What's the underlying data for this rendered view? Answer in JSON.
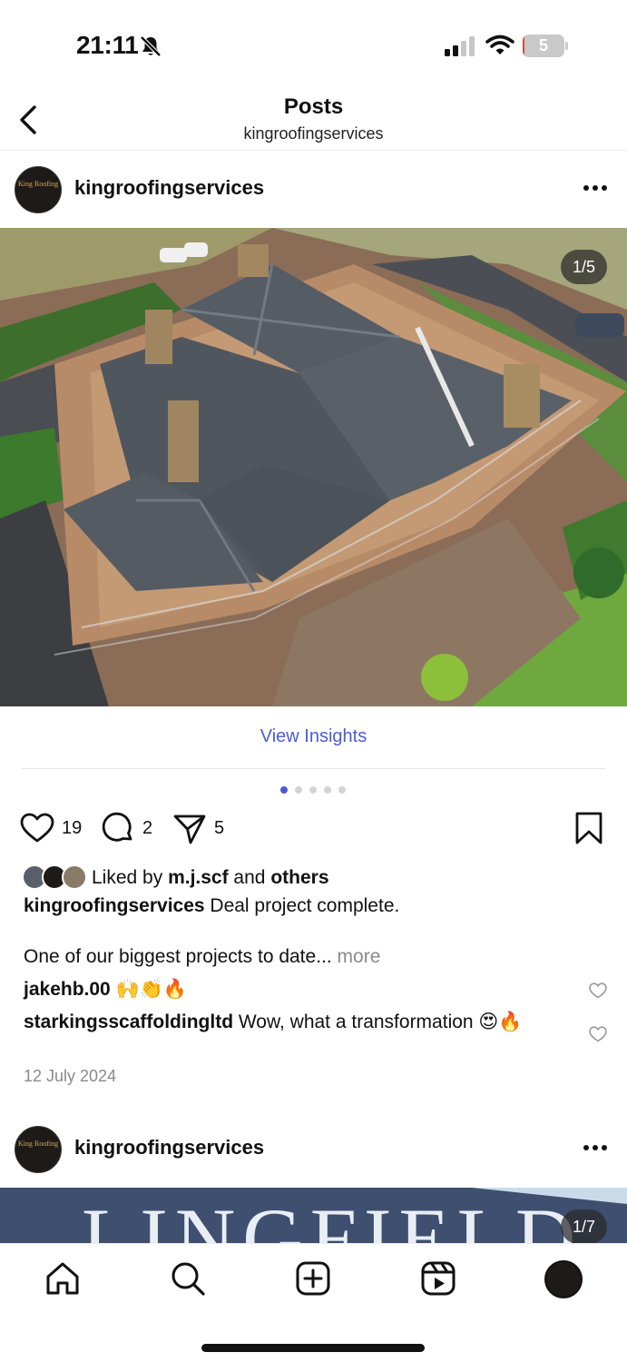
{
  "status_bar": {
    "time": "21:11",
    "battery_level": "5",
    "icons": [
      "bell-slash-icon",
      "signal-icon",
      "wifi-icon",
      "battery-icon"
    ]
  },
  "header": {
    "title": "Posts",
    "subtitle": "kingroofingservices",
    "back_icon": "chevron-left-icon"
  },
  "post1": {
    "username": "kingroofingservices",
    "avatar_text": [
      "King Roofing"
    ],
    "image_counter": "1/5",
    "view_insights": "View Insights",
    "carousel": {
      "total": 5,
      "active": 1
    },
    "like_count": "19",
    "comment_count": "2",
    "share_count": "5",
    "likes_text": {
      "prefix": "Liked by ",
      "user": "m.j.scf",
      "middle": " and ",
      "others": "others"
    },
    "caption": {
      "username": "kingroofingservices",
      "text": " Deal project complete.",
      "line2": "One of our biggest projects to date...",
      "more": "more"
    },
    "comments": [
      {
        "username": "jakehb.00",
        "text": " 🙌👏🔥"
      },
      {
        "username": "starkingsscaffoldingltd",
        "text": " Wow, what a transformation 😍🔥"
      }
    ],
    "date": "12 July 2024"
  },
  "post2": {
    "username": "kingroofingservices",
    "image_counter": "1/7",
    "image_text": "LINGFIELD"
  },
  "bottom_nav": {
    "items": [
      "home-icon",
      "search-icon",
      "create-icon",
      "reels-icon",
      "profile-avatar"
    ]
  },
  "colors": {
    "accent": "#4d5bd6",
    "battery_low": "#e7453b",
    "muted_text": "#8a8a8a"
  }
}
